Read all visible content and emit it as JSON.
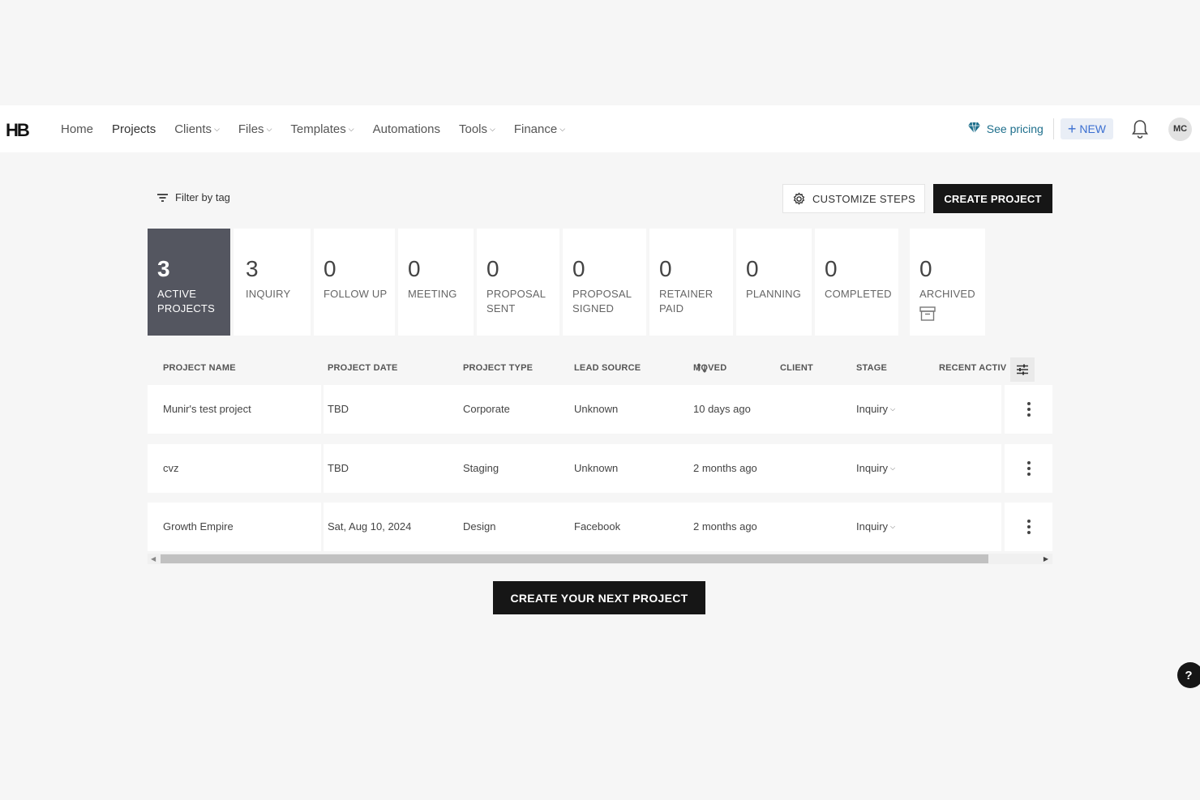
{
  "nav": {
    "logo": "HB",
    "items": [
      {
        "label": "Home",
        "dropdown": false
      },
      {
        "label": "Projects",
        "dropdown": false
      },
      {
        "label": "Clients",
        "dropdown": true
      },
      {
        "label": "Files",
        "dropdown": true
      },
      {
        "label": "Templates",
        "dropdown": true
      },
      {
        "label": "Automations",
        "dropdown": false
      },
      {
        "label": "Tools",
        "dropdown": true
      },
      {
        "label": "Finance",
        "dropdown": true
      }
    ],
    "pricing_label": "See pricing",
    "new_label": "NEW",
    "avatar_initials": "MC"
  },
  "toolbar": {
    "filter_label": "Filter by tag",
    "customize_label": "CUSTOMIZE STEPS",
    "create_label": "CREATE PROJECT"
  },
  "steps": [
    {
      "count": "3",
      "label": "ACTIVE PROJECTS",
      "active": true
    },
    {
      "count": "3",
      "label": "INQUIRY"
    },
    {
      "count": "0",
      "label": "FOLLOW UP"
    },
    {
      "count": "0",
      "label": "MEETING"
    },
    {
      "count": "0",
      "label": "PROPOSAL SENT"
    },
    {
      "count": "0",
      "label": "PROPOSAL SIGNED"
    },
    {
      "count": "0",
      "label": "RETAINER PAID"
    },
    {
      "count": "0",
      "label": "PLANNING"
    },
    {
      "count": "0",
      "label": "COMPLETED"
    },
    {
      "count": "0",
      "label": "ARCHIVED"
    }
  ],
  "table": {
    "columns": [
      "PROJECT NAME",
      "PROJECT DATE",
      "PROJECT TYPE",
      "LEAD SOURCE",
      "MOVED",
      "CLIENT",
      "STAGE",
      "RECENT ACTIV"
    ],
    "rows": [
      {
        "name": "Munir's test project",
        "date": "TBD",
        "type": "Corporate",
        "source": "Unknown",
        "moved": "10 days ago",
        "client": "",
        "stage": "Inquiry"
      },
      {
        "name": "cvz",
        "date": "TBD",
        "type": "Staging",
        "source": "Unknown",
        "moved": "2 months ago",
        "client": "",
        "stage": "Inquiry"
      },
      {
        "name": "Growth Empire",
        "date": "Sat, Aug 10, 2024",
        "type": "Design",
        "source": "Facebook",
        "moved": "2 months ago",
        "client": "",
        "stage": "Inquiry"
      }
    ]
  },
  "cta_label": "CREATE YOUR NEXT PROJECT",
  "help_label": "?"
}
